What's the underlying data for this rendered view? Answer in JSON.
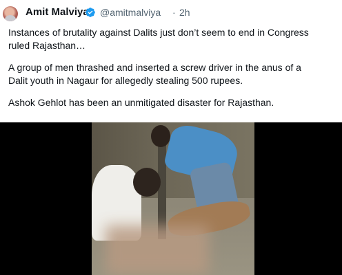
{
  "user": {
    "name": "Amit Malviya",
    "handle": "@amitmalviya",
    "separator": "·",
    "time": "2h",
    "verified_icon": "verified-badge-icon",
    "badge_color": "#1d9bf0"
  },
  "tweet": {
    "paragraphs": [
      "Instances of brutality against Dalits just don’t seem to end in Congress\nruled Rajasthan…",
      "A group of men thrashed and inserted a screw driver in the anus of a\nDalit youth in Nagaur for allegedly stealing 500 rupees.",
      "Ashok Gehlot has been an unmitigated disaster for Rajasthan."
    ]
  },
  "media": {
    "type": "video",
    "background": "#000000"
  }
}
